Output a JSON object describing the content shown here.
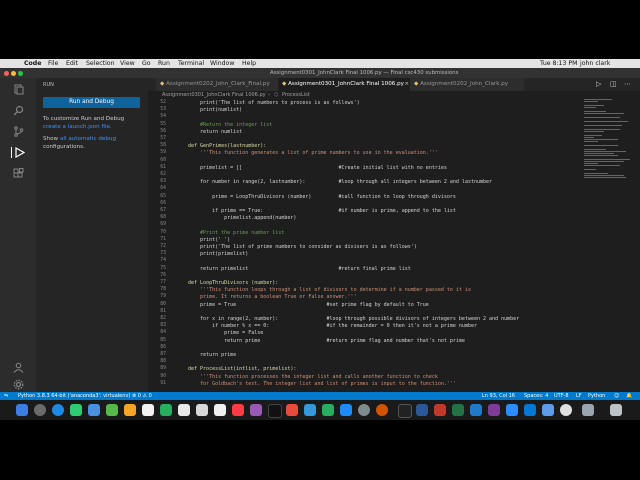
{
  "menubar": {
    "apple": "",
    "items": [
      "Code",
      "File",
      "Edit",
      "Selection",
      "View",
      "Go",
      "Run",
      "Terminal",
      "Window",
      "Help"
    ],
    "clock": "Tue 8:13 PM",
    "user": "john clark"
  },
  "window": {
    "title": "Assignment0301_JohnClark Final 1006.py — Final csc430 submissions"
  },
  "sidebar": {
    "header": "RUN",
    "run_button": "Run and Debug",
    "customize_text": "To customize Run and Debug",
    "launch_link": "create a launch.json file.",
    "show_text": "Show",
    "all_link": "all automatic debug",
    "configs_text": "configurations."
  },
  "tabs": [
    {
      "label": "Assignment0202_John_Clark_Final.py"
    },
    {
      "label": "Assignment0301_JohnClark Final 1006.py"
    },
    {
      "label": "Assignment0202_John_Clark.py"
    }
  ],
  "breadcrumb": [
    "Assignment0301_JohnClark Final 1006.py",
    "ProcessList"
  ],
  "code_lines": [
    {
      "n": "52",
      "t": "    print('The list of numbers to process is as follows')",
      "c": "#d4d4d4"
    },
    {
      "n": "53",
      "t": "    print(numlist)",
      "c": "#d4d4d4"
    },
    {
      "n": "54",
      "t": "",
      "c": "#d4d4d4"
    },
    {
      "n": "55",
      "t": "    #Return the integer list",
      "c": "#6a9955"
    },
    {
      "n": "56",
      "t": "    return numlist",
      "c": "#d4d4d4"
    },
    {
      "n": "57",
      "t": "",
      "c": "#d4d4d4"
    },
    {
      "n": "58",
      "t": "def GenPrimes(lastnumber):",
      "c": "#dcdcaa"
    },
    {
      "n": "59",
      "t": "    '''This function generates a list of prime numbers to use in the evaluation.'''",
      "c": "#ce9178"
    },
    {
      "n": "60",
      "t": "",
      "c": "#d4d4d4"
    },
    {
      "n": "61",
      "t": "    primelist = []                                #Create initial list with no entries",
      "c": "#d4d4d4"
    },
    {
      "n": "62",
      "t": "",
      "c": "#d4d4d4"
    },
    {
      "n": "63",
      "t": "    for number in range(2, lastnumber):           #loop through all integers between 2 and lastnumber",
      "c": "#d4d4d4"
    },
    {
      "n": "64",
      "t": "",
      "c": "#d4d4d4"
    },
    {
      "n": "65",
      "t": "        prime = LoopThruDivisors (number)         #call function to loop through divisors",
      "c": "#d4d4d4"
    },
    {
      "n": "66",
      "t": "",
      "c": "#d4d4d4"
    },
    {
      "n": "67",
      "t": "        if prime == True:                         #if number is prime, append to the list",
      "c": "#d4d4d4"
    },
    {
      "n": "68",
      "t": "            primelist.append(number)",
      "c": "#d4d4d4"
    },
    {
      "n": "69",
      "t": "",
      "c": "#d4d4d4"
    },
    {
      "n": "70",
      "t": "    #Print the prime number list",
      "c": "#6a9955"
    },
    {
      "n": "71",
      "t": "    print(' ')",
      "c": "#d4d4d4"
    },
    {
      "n": "72",
      "t": "    print('The list of prime numbers to consider as divisers is as follows')",
      "c": "#d4d4d4"
    },
    {
      "n": "73",
      "t": "    print(primelist)",
      "c": "#d4d4d4"
    },
    {
      "n": "74",
      "t": "",
      "c": "#d4d4d4"
    },
    {
      "n": "75",
      "t": "    return primelist                              #return final prime list",
      "c": "#d4d4d4"
    },
    {
      "n": "76",
      "t": "",
      "c": "#d4d4d4"
    },
    {
      "n": "77",
      "t": "def LoopThruDivisors (number):",
      "c": "#dcdcaa"
    },
    {
      "n": "78",
      "t": "    '''This function loops through a list of divisors to determine if a number passed to it is",
      "c": "#ce9178"
    },
    {
      "n": "79",
      "t": "    prime. It returns a boolean True or False answer.'''",
      "c": "#ce9178"
    },
    {
      "n": "80",
      "t": "    prime = True                              #set prime flag by default to True",
      "c": "#d4d4d4"
    },
    {
      "n": "81",
      "t": "",
      "c": "#d4d4d4"
    },
    {
      "n": "82",
      "t": "    for x in range(2, number):                #loop through possible divisors of integers between 2 and number",
      "c": "#d4d4d4"
    },
    {
      "n": "83",
      "t": "        if number % x == 0:                   #if the remainder = 0 then it's not a prime number",
      "c": "#d4d4d4"
    },
    {
      "n": "84",
      "t": "            prime = False",
      "c": "#d4d4d4"
    },
    {
      "n": "85",
      "t": "            return prime                      #return prime flag and number that's not prime",
      "c": "#d4d4d4"
    },
    {
      "n": "86",
      "t": "",
      "c": "#d4d4d4"
    },
    {
      "n": "87",
      "t": "    return prime",
      "c": "#d4d4d4"
    },
    {
      "n": "88",
      "t": "",
      "c": "#d4d4d4"
    },
    {
      "n": "89",
      "t": "def ProcessList(intlist, primelist):",
      "c": "#dcdcaa"
    },
    {
      "n": "90",
      "t": "    '''This function processes the integer list and calls another function to check",
      "c": "#ce9178"
    },
    {
      "n": "91",
      "t": "    for Goldbach's test. The integer list and list of primes is input to the function.'''",
      "c": "#ce9178"
    }
  ],
  "statusbar": {
    "interpreter": "Python 3.8.3 64-bit ('anaconda3': virtualenv)",
    "problems": "⊗ 0 ⚠ 0",
    "position": "Ln 93, Col 16",
    "spaces": "Spaces: 4",
    "encoding": "UTF-8",
    "eol": "LF",
    "language": "Python"
  },
  "colors": {
    "accent": "#007acc",
    "run_button": "#0e639c",
    "keyword": "#569cd6",
    "comment": "#6a9955",
    "string": "#ce9178",
    "function": "#dcdcaa"
  },
  "icons": [
    "explorer-icon",
    "search-icon",
    "source-control-icon",
    "run-debug-icon",
    "extensions-icon",
    "accounts-icon",
    "settings-gear-icon"
  ]
}
